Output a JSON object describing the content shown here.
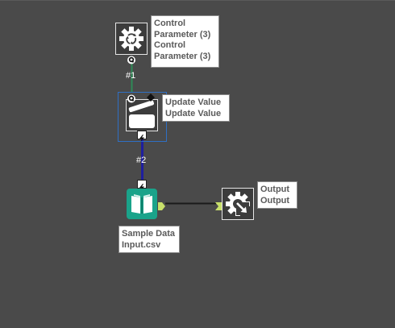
{
  "canvas": {
    "background": "#4a4a4a"
  },
  "tools": {
    "control_parameter": {
      "icon": "gear-icon",
      "color": "#3c3c3c",
      "label_line1": "Control",
      "label_line2": "Parameter (3)",
      "label_line3": "Control",
      "label_line4": "Parameter (3)",
      "anchor_q": "Q"
    },
    "update_value": {
      "icon": "clapper-icon",
      "color": "#3c3c3c",
      "label_line1": "Update Value",
      "label_line2": "Update Value",
      "anchor_q": "Q"
    },
    "input_data": {
      "icon": "book-icon",
      "color": "#1aa38a",
      "label_line1": "Sample Data",
      "label_line2": "Input.csv"
    },
    "output": {
      "icon": "gear-arrow-icon",
      "color": "#3c3c3c",
      "label_line1": "Output",
      "label_line2": "Output"
    }
  },
  "connections": {
    "first": "#1",
    "second": "#2"
  },
  "colors": {
    "wire_green": "#2e8b57",
    "wire_blue": "#1f1f9e",
    "wire_black": "#1a1a1a",
    "selection": "#2f6fc4",
    "anchor_lime": "#c8e06a"
  }
}
